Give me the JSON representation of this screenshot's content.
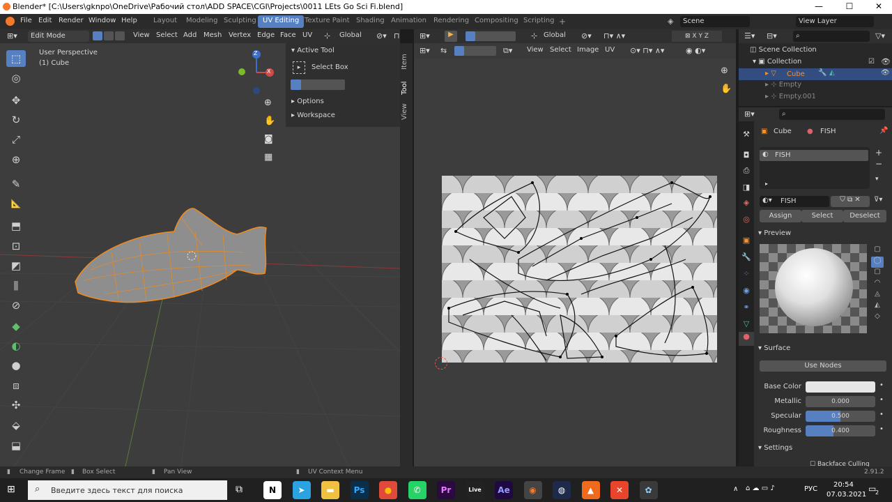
{
  "window": {
    "title": "Blender* [C:\\Users\\gknpo\\OneDrive\\Рабочий стол\\ADD SPACE\\CGI\\Projects\\0011 LEts Go Sci Fi.blend]",
    "minimize": "—",
    "maximize": "☐",
    "close": "✕"
  },
  "menu": [
    "File",
    "Edit",
    "Render",
    "Window",
    "Help"
  ],
  "workspaces": [
    "Layout",
    "Modeling",
    "Sculpting",
    "UV Editing",
    "Texture Paint",
    "Shading",
    "Animation",
    "Rendering",
    "Compositing",
    "Scripting"
  ],
  "add_workspace": "+",
  "scene": "Scene",
  "view_layer": "View Layer",
  "viewport": {
    "mode": "Edit Mode",
    "menu": [
      "View",
      "Select",
      "Add",
      "Mesh",
      "Vertex",
      "Edge",
      "Face",
      "UV"
    ],
    "orientation": "Global",
    "overlay_line1": "User Perspective",
    "overlay_line2": "(1) Cube",
    "gizmo_z": "Z",
    "gizmo_x": "X",
    "tools": [
      "select-box-icon",
      "cursor-icon",
      "move-icon",
      "rotate-icon",
      "scale-icon",
      "transform-icon",
      "annotate-icon",
      "measure-icon",
      "extrude-icon",
      "inset-icon",
      "bevel-icon",
      "loopcut-icon",
      "knife-icon",
      "polybuild-icon",
      "spin-icon",
      "smooth-icon",
      "edge-slide-icon",
      "shrink-icon",
      "shear-icon",
      "rip-icon"
    ],
    "tool_glyphs": [
      "⬚",
      "◎",
      "✥",
      "↻",
      "⤢",
      "⊕",
      "✎",
      "📐",
      "⬒",
      "⊡",
      "◩",
      "⫼",
      "⊘",
      "◆",
      "◐",
      "●",
      "⧈",
      "✣",
      "⬙",
      "⬓"
    ]
  },
  "npanel": {
    "active_tool": "Active Tool",
    "select_box": "Select Box",
    "options": "Options",
    "workspace": "Workspace",
    "tabs": [
      "Item",
      "Tool",
      "View"
    ]
  },
  "uv_editor": {
    "menu": [
      "View",
      "Select",
      "Image",
      "UV"
    ]
  },
  "outliner": {
    "scene_collection": "Scene Collection",
    "items": [
      {
        "name": "Collection",
        "level": 1
      },
      {
        "name": "Cube",
        "level": 2,
        "selected": true
      },
      {
        "name": "Empty",
        "level": 2
      },
      {
        "name": "Empty.001",
        "level": 2
      }
    ]
  },
  "properties": {
    "object": "Cube",
    "material": "FISH",
    "slot": "FISH",
    "material_field": "FISH",
    "assign": "Assign",
    "select": "Select",
    "deselect": "Deselect",
    "preview": "Preview",
    "surface": "Surface",
    "use_nodes": "Use Nodes",
    "base_color_label": "Base Color",
    "base_color": "#e6e6e6",
    "metallic_label": "Metallic",
    "metallic": "0.000",
    "metallic_value": 0,
    "specular_label": "Specular",
    "specular": "0.500",
    "specular_value": 0.5,
    "roughness_label": "Roughness",
    "roughness": "0.400",
    "roughness_value": 0.4,
    "settings": "Settings",
    "backface": "Backface Culling"
  },
  "statusbar": {
    "change_frame": "Change Frame",
    "box_select": "Box Select",
    "pan_view": "Pan View",
    "uv_context": "UV Context Menu",
    "version": "2.91.2"
  },
  "taskbar": {
    "search_placeholder": "Введите здесь текст для поиска",
    "apps": [
      {
        "name": "notion",
        "label": "N",
        "color": "#ffffff",
        "text": "#000"
      },
      {
        "name": "telegram",
        "label": "➤",
        "color": "#2aa3e0",
        "text": "#fff"
      },
      {
        "name": "explorer",
        "label": "▬",
        "color": "#f0c040",
        "text": "#fff"
      },
      {
        "name": "photoshop",
        "label": "Ps",
        "color": "#0b2f4a",
        "text": "#31a8ff"
      },
      {
        "name": "chrome",
        "label": "●",
        "color": "#e04a3a",
        "text": "#fbbc05"
      },
      {
        "name": "whatsapp",
        "label": "✆",
        "color": "#25d366",
        "text": "#fff"
      },
      {
        "name": "premiere",
        "label": "Pr",
        "color": "#2a0a3f",
        "text": "#ea77ff"
      },
      {
        "name": "live",
        "label": "Live",
        "color": "#222",
        "text": "#fff"
      },
      {
        "name": "after-effects",
        "label": "Ae",
        "color": "#1e0a40",
        "text": "#9999ff"
      },
      {
        "name": "blender",
        "label": "◉",
        "color": "#444",
        "text": "#f5792a"
      },
      {
        "name": "cinema4d",
        "label": "◍",
        "color": "#1e2a4a",
        "text": "#fff"
      },
      {
        "name": "app-orange",
        "label": "▲",
        "color": "#f06a1e",
        "text": "#fff"
      },
      {
        "name": "app-x",
        "label": "✕",
        "color": "#e8452c",
        "text": "#fff"
      },
      {
        "name": "app-paint",
        "label": "✿",
        "color": "#3a3a3a",
        "text": "#8fd4ff"
      }
    ],
    "lang": "РУС",
    "time": "20:54",
    "date": "07.03.2021",
    "notif_count": "2"
  }
}
